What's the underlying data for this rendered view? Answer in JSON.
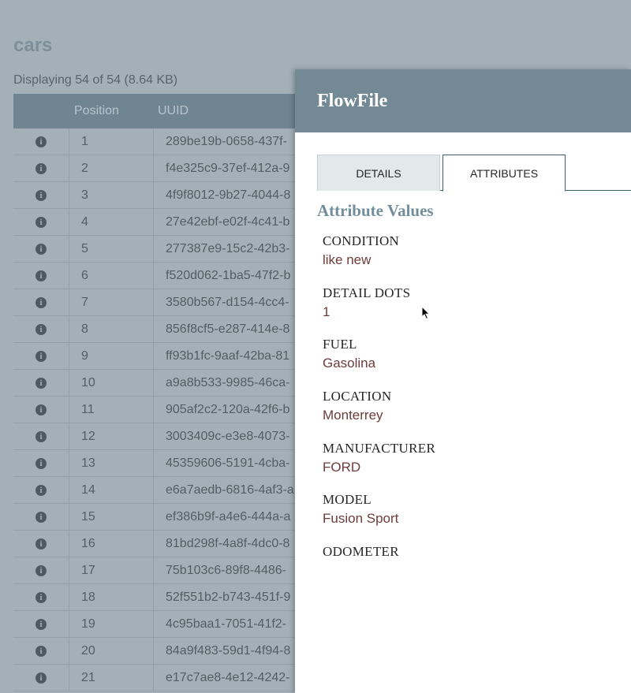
{
  "queue": {
    "title": "cars",
    "summary": "Displaying 54 of 54 (8.64 KB)",
    "columns": {
      "position": "Position",
      "uuid": "UUID"
    },
    "rows": [
      {
        "position": "1",
        "uuid": "289be19b-0658-437f-"
      },
      {
        "position": "2",
        "uuid": "f4e325c9-37ef-412a-9"
      },
      {
        "position": "3",
        "uuid": "4f9f8012-9b27-4044-8"
      },
      {
        "position": "4",
        "uuid": "27e42ebf-e02f-4c41-b"
      },
      {
        "position": "5",
        "uuid": "277387e9-15c2-42b3-"
      },
      {
        "position": "6",
        "uuid": "f520d062-1ba5-47f2-b"
      },
      {
        "position": "7",
        "uuid": "3580b567-d154-4cc4-"
      },
      {
        "position": "8",
        "uuid": "856f8cf5-e287-414e-8"
      },
      {
        "position": "9",
        "uuid": "ff93b1fc-9aaf-42ba-81"
      },
      {
        "position": "10",
        "uuid": "a9a8b533-9985-46ca-"
      },
      {
        "position": "11",
        "uuid": "905af2c2-120a-42f6-b"
      },
      {
        "position": "12",
        "uuid": "3003409c-e3e8-4073-"
      },
      {
        "position": "13",
        "uuid": "45359606-5191-4cba-"
      },
      {
        "position": "14",
        "uuid": "e6a7aedb-6816-4af3-a"
      },
      {
        "position": "15",
        "uuid": "ef386b9f-a4e6-444a-a"
      },
      {
        "position": "16",
        "uuid": "81bd298f-4a8f-4dc0-8"
      },
      {
        "position": "17",
        "uuid": "75b103c6-89f8-4486-"
      },
      {
        "position": "18",
        "uuid": "52f551b2-b743-451f-9"
      },
      {
        "position": "19",
        "uuid": "4c95baa1-7051-41f2-"
      },
      {
        "position": "20",
        "uuid": "84a9f483-59d1-4f94-8"
      },
      {
        "position": "21",
        "uuid": "e17c7ae8-4e12-4242-"
      }
    ]
  },
  "dialog": {
    "title": "FlowFile",
    "tabs": {
      "details": "DETAILS",
      "attributes": "ATTRIBUTES"
    },
    "section_heading": "Attribute Values",
    "attributes": [
      {
        "name": "CONDITION",
        "value": "like new"
      },
      {
        "name": "DETAIL DOTS",
        "value": "1"
      },
      {
        "name": "FUEL",
        "value": "Gasolina"
      },
      {
        "name": "LOCATION",
        "value": "Monterrey"
      },
      {
        "name": "MANUFACTURER",
        "value": "FORD"
      },
      {
        "name": "MODEL",
        "value": "Fusion Sport"
      },
      {
        "name": "ODOMETER",
        "value": ""
      }
    ]
  },
  "icons": {
    "row_info": "info-icon",
    "cursor": "mouse-pointer-icon"
  },
  "colors": {
    "overlay_bg": "#a3b0b8",
    "dialog_header": "#738a96",
    "heading": "#728e9b",
    "value_text": "#6b3c3a"
  }
}
